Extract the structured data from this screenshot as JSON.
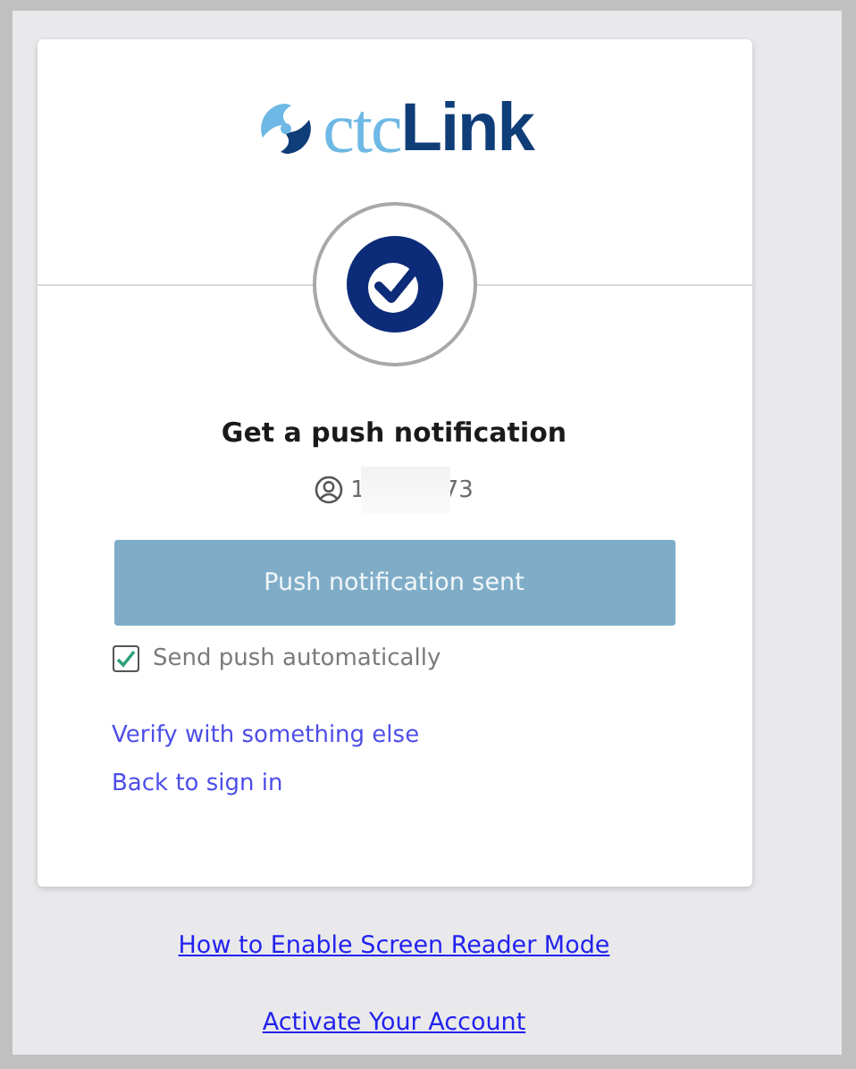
{
  "logo": {
    "part_1": "ctc",
    "part_2": "Link"
  },
  "title": "Get a push notification",
  "user": {
    "start": "1",
    "end": "73",
    "redacted": true
  },
  "push_button": {
    "label": "Push notification sent",
    "disabled": true
  },
  "auto_push": {
    "label": "Send push automatically",
    "checked": true
  },
  "card_links": [
    "Verify with something else",
    "Back to sign in"
  ],
  "footer_links": [
    "How to Enable Screen Reader Mode",
    "Activate Your Account"
  ]
}
